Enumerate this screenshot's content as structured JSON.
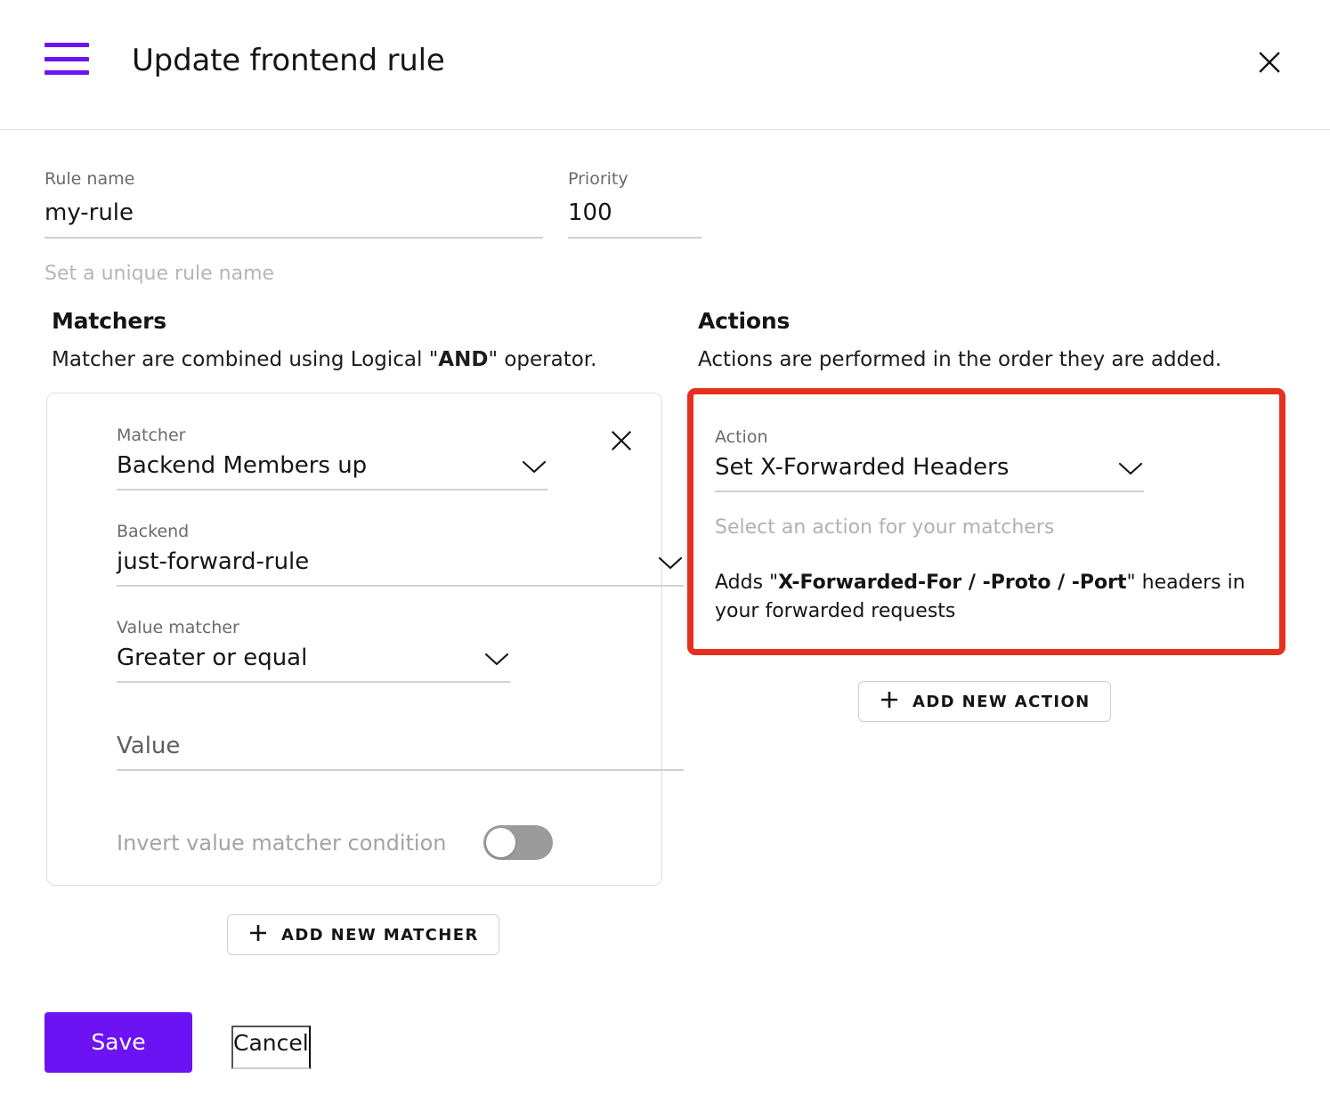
{
  "header": {
    "title": "Update frontend rule",
    "menu_icon": "hamburger-icon",
    "close_icon": "close-icon"
  },
  "form": {
    "rule_name": {
      "label": "Rule name",
      "value": "my-rule"
    },
    "priority": {
      "label": "Priority",
      "value": "100"
    },
    "helper_text": "Set a unique rule name"
  },
  "matchers": {
    "title": "Matchers",
    "description_prefix": "Matcher are combined using Logical \"",
    "description_bold": "AND",
    "description_suffix": "\" operator.",
    "card": {
      "remove_icon": "close-icon",
      "matcher": {
        "label": "Matcher",
        "value": "Backend Members up",
        "chevron": "chevron-down-icon"
      },
      "backend": {
        "label": "Backend",
        "value": "just-forward-rule",
        "chevron": "chevron-down-icon"
      },
      "value_matcher": {
        "label": "Value matcher",
        "value": "Greater or equal",
        "chevron": "chevron-down-icon"
      },
      "value": {
        "label": "",
        "placeholder": "Value",
        "value": ""
      },
      "invert_toggle": {
        "label": "Invert value matcher condition",
        "state": "off"
      }
    },
    "add_button": {
      "label": "ADD NEW MATCHER",
      "icon": "plus-icon"
    }
  },
  "actions": {
    "title": "Actions",
    "description": "Actions are performed in the order they are added.",
    "highlighted": true,
    "highlight_color": "#e6301f",
    "card": {
      "action": {
        "label": "Action",
        "value": "Set X-Forwarded Headers",
        "chevron": "chevron-down-icon"
      },
      "helper_text": "Select an action for your matchers",
      "description_prefix": "Adds \"",
      "description_bold": "X-Forwarded-For / -Proto / -Port",
      "description_suffix": "\" headers in your forwarded requests"
    },
    "add_button": {
      "label": "ADD NEW ACTION",
      "icon": "plus-icon"
    }
  },
  "footer": {
    "save_label": "Save",
    "cancel_label": "Cancel",
    "save_color": "#6d12f2"
  }
}
